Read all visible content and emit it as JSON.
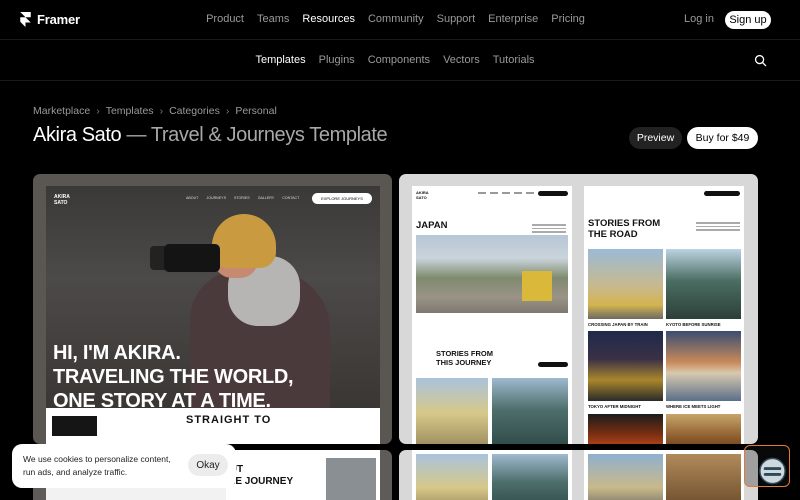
{
  "brand": {
    "name": "Framer"
  },
  "nav": {
    "items": [
      {
        "label": "Product",
        "active": false
      },
      {
        "label": "Teams",
        "active": false
      },
      {
        "label": "Resources",
        "active": true
      },
      {
        "label": "Community",
        "active": false
      },
      {
        "label": "Support",
        "active": false
      },
      {
        "label": "Enterprise",
        "active": false
      },
      {
        "label": "Pricing",
        "active": false
      }
    ],
    "login": "Log in",
    "signup": "Sign up"
  },
  "subnav": {
    "items": [
      {
        "label": "Templates",
        "active": true
      },
      {
        "label": "Plugins",
        "active": false
      },
      {
        "label": "Components",
        "active": false
      },
      {
        "label": "Vectors",
        "active": false
      },
      {
        "label": "Tutorials",
        "active": false
      }
    ],
    "search_icon": "search-icon"
  },
  "breadcrumb": [
    "Marketplace",
    "Templates",
    "Categories",
    "Personal"
  ],
  "page": {
    "title_main": "Akira Sato",
    "title_sub": " — Travel & Journeys Template",
    "preview_label": "Preview",
    "buy_label": "Buy for $49"
  },
  "preview_left": {
    "site_logo": [
      "AKIRA",
      "SATO"
    ],
    "site_links": [
      "ABOUT",
      "JOURNEYS",
      "STORIES",
      "GALLERY",
      "CONTACT"
    ],
    "site_button": "EXPLORE JOURNEYS",
    "hero_lines": [
      "HI, I'M AKIRA.",
      "TRAVELING THE WORLD,",
      "ONE STORY AT A TIME."
    ],
    "band_text": "STRAIGHT TO"
  },
  "preview_right": {
    "page_a": {
      "logo": [
        "AKIRA",
        "SATO"
      ],
      "heading": "JAPAN",
      "heading2": [
        "STORIES FROM",
        "THIS JOURNEY"
      ]
    },
    "page_b": {
      "logo": "",
      "heading": [
        "STORIES FROM",
        "THE ROAD"
      ],
      "captions": [
        "CROSSING JAPAN BY TRAIN",
        "KYOTO BEFORE SUNRISE",
        "TOKYO AFTER MIDNIGHT",
        "WHERE ICE MEETS LIGHT"
      ]
    }
  },
  "preview_bottom_left": {
    "text": [
      "OUT",
      "THE JOURNEY"
    ]
  },
  "cookie": {
    "text": "We use cookies to personalize content, run ads, and analyze traffic.",
    "button": "Okay"
  },
  "widget": {
    "icon": "chat-widget-icon"
  },
  "colors": {
    "background": "#000000",
    "muted_text": "#9a9a9a",
    "widget_border": "#e07a3b"
  }
}
